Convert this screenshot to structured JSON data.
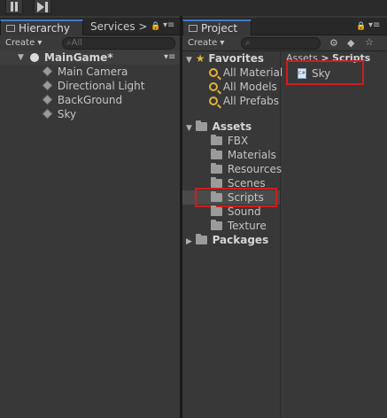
{
  "hierarchy": {
    "tabs": [
      {
        "label": "Hierarchy"
      },
      {
        "label": "Services"
      }
    ],
    "create_label": "Create",
    "search_placeholder": "All",
    "scene": "MainGame*",
    "objects": [
      "Main Camera",
      "Directional Light",
      "BackGround",
      "Sky"
    ]
  },
  "project": {
    "tab_label": "Project",
    "create_label": "Create",
    "favorites": {
      "label": "Favorites",
      "items": [
        "All Material",
        "All Models",
        "All Prefabs"
      ]
    },
    "assets": {
      "label": "Assets",
      "folders": [
        "FBX",
        "Materials",
        "Resources",
        "Scenes",
        "Scripts",
        "Sound",
        "Texture"
      ]
    },
    "packages_label": "Packages",
    "breadcrumb": {
      "root": "Assets",
      "separator": ">",
      "current": "Scripts"
    },
    "files": [
      {
        "name": "Sky",
        "icon": "csharp-script-icon"
      }
    ]
  },
  "colors": {
    "highlight": "#d01c1c",
    "accent": "#3d7bc8",
    "favorite": "#e2b23a"
  }
}
